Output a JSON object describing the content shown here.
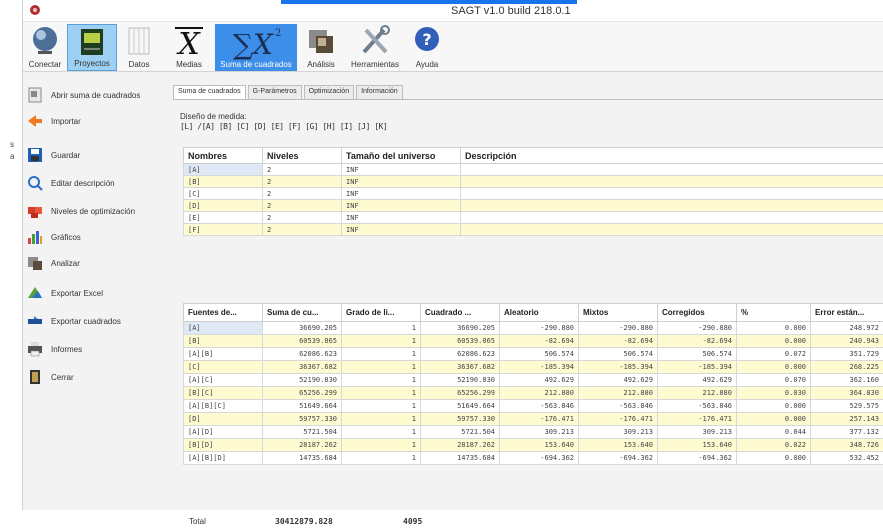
{
  "window": {
    "title": "SAGT v1.0 build 218.0.1"
  },
  "external": {
    "frag1": "s",
    "frag2": "a"
  },
  "ribbon": {
    "buttons": [
      {
        "name": "conectar",
        "label": "Conectar"
      },
      {
        "name": "proyectos",
        "label": "Proyectos"
      },
      {
        "name": "datos",
        "label": "Datos"
      },
      {
        "name": "medias",
        "label": "Medias"
      },
      {
        "name": "suma-de-cuadrados",
        "label": "Suma de cuadrados"
      },
      {
        "name": "analisis",
        "label": "Análisis"
      },
      {
        "name": "herramientas",
        "label": "Herramientas"
      },
      {
        "name": "ayuda",
        "label": "Ayuda"
      }
    ],
    "icon_text": {
      "medias": "X",
      "suma": "∑X",
      "suma_sup": "2"
    }
  },
  "sidebar": {
    "items": [
      {
        "label": "Abrir suma de cuadrados",
        "icon": "open-file-icon"
      },
      {
        "label": "Importar",
        "icon": "import-arrow-icon"
      },
      {
        "label": "Guardar",
        "icon": "floppy-disk-icon"
      },
      {
        "label": "Editar descripción",
        "icon": "edit-magnifier-icon"
      },
      {
        "label": "Niveles de optimización",
        "icon": "puzzle-icon"
      },
      {
        "label": "Gráficos",
        "icon": "chart-icon"
      },
      {
        "label": "Analizar",
        "icon": "analyze-icon"
      },
      {
        "label": "Exportar Excel",
        "icon": "excel-export-icon"
      },
      {
        "label": "Exportar cuadrados",
        "icon": "export-squares-icon"
      },
      {
        "label": "Informes",
        "icon": "printer-icon"
      },
      {
        "label": "Cerrar",
        "icon": "close-door-icon"
      }
    ]
  },
  "tabs": [
    "Suma de cuadrados",
    "G-Parámetros",
    "Optimización",
    "Información"
  ],
  "design": {
    "label": "Diseño de medida:",
    "value": "[L] /[A] [B] [C] [D] [E] [F] [G] [H] [I] [J] [K]"
  },
  "grid1": {
    "headers": [
      "Nombres",
      "Niveles",
      "Tamaño del universo",
      "Descripción"
    ],
    "rows": [
      [
        "[A]",
        "2",
        "INF",
        ""
      ],
      [
        "[B]",
        "2",
        "INF",
        ""
      ],
      [
        "[C]",
        "2",
        "INF",
        ""
      ],
      [
        "[D]",
        "2",
        "INF",
        ""
      ],
      [
        "[E]",
        "2",
        "INF",
        ""
      ],
      [
        "[F]",
        "2",
        "INF",
        ""
      ]
    ]
  },
  "grid2": {
    "headers": [
      "Fuentes de...",
      "Suma de cu...",
      "Grado de li...",
      "Cuadrado ...",
      "Aleatorio",
      "Mixtos",
      "Corregidos",
      "%",
      "Error están..."
    ],
    "rows": [
      [
        "[A]",
        "36690.205",
        "1",
        "36690.205",
        "-290.880",
        "-290.880",
        "-290.880",
        "0.000",
        "248.972"
      ],
      [
        "[B]",
        "60539.065",
        "1",
        "60539.065",
        "-82.694",
        "-82.694",
        "-82.694",
        "0.000",
        "240.943"
      ],
      [
        "[A][B]",
        "62086.623",
        "1",
        "62086.623",
        "506.574",
        "506.574",
        "506.574",
        "0.072",
        "351.729"
      ],
      [
        "[C]",
        "36367.682",
        "1",
        "36367.682",
        "-185.394",
        "-185.394",
        "-185.394",
        "0.000",
        "268.225"
      ],
      [
        "[A][C]",
        "52190.830",
        "1",
        "52190.830",
        "492.629",
        "492.629",
        "492.629",
        "0.070",
        "362.160"
      ],
      [
        "[B][C]",
        "65256.299",
        "1",
        "65256.299",
        "212.880",
        "212.880",
        "212.880",
        "0.030",
        "364.830"
      ],
      [
        "[A][B][C]",
        "51649.664",
        "1",
        "51649.664",
        "-563.846",
        "-563.846",
        "-563.846",
        "0.000",
        "529.575"
      ],
      [
        "[D]",
        "59757.330",
        "1",
        "59757.330",
        "-176.471",
        "-176.471",
        "-176.471",
        "0.000",
        "257.143"
      ],
      [
        "[A][D]",
        "5721.504",
        "1",
        "5721.504",
        "309.213",
        "309.213",
        "309.213",
        "0.044",
        "377.132"
      ],
      [
        "[B][D]",
        "28187.262",
        "1",
        "28187.262",
        "153.640",
        "153.640",
        "153.640",
        "0.022",
        "348.726"
      ],
      [
        "[A][B][D]",
        "14735.684",
        "1",
        "14735.684",
        "-694.362",
        "-694.362",
        "-694.362",
        "0.000",
        "532.452"
      ]
    ]
  },
  "totals": {
    "label": "Total",
    "sum": "30412879.828",
    "df": "4095"
  }
}
